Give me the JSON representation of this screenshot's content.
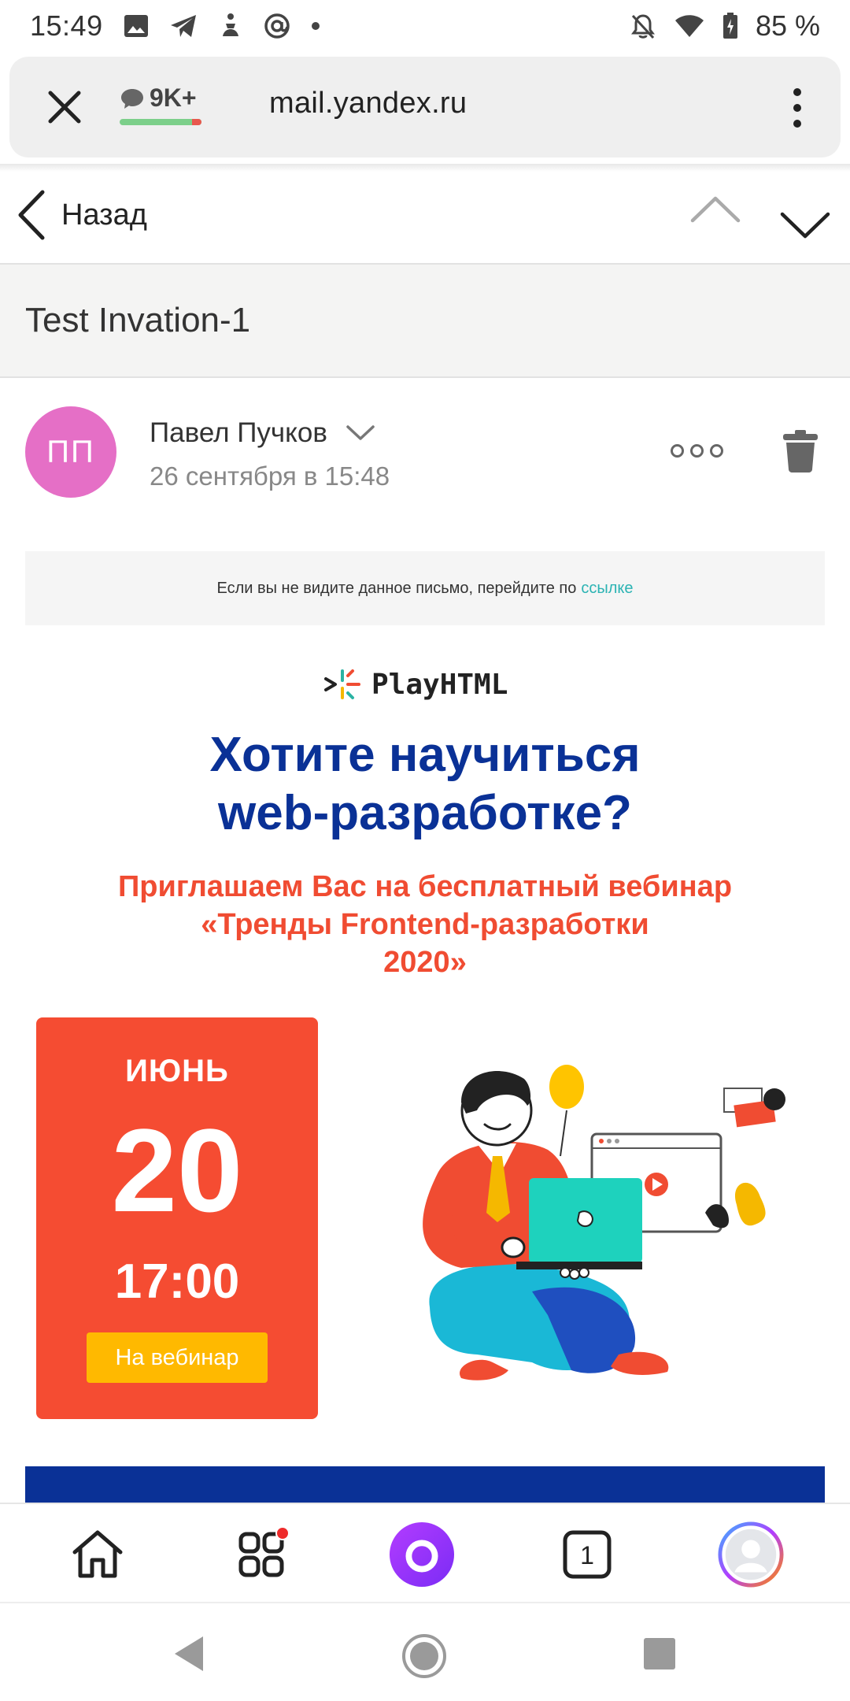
{
  "status_bar": {
    "time": "15:49",
    "battery": "85 %"
  },
  "browser": {
    "comments_count": "9K+",
    "url": "mail.yandex.ru"
  },
  "nav": {
    "back_label": "Назад"
  },
  "email": {
    "subject": "Test Invation-1",
    "sender_initials": "ПП",
    "sender_name": "Павел Пучков",
    "date": "26 сентября в 15:48",
    "avatar_color": "#e56fc6"
  },
  "body": {
    "notice_text": "Если вы не видите данное письмо, перейдите по",
    "notice_link": "ссылке",
    "logo_name": "PlayHTML",
    "headline_line1": "Хотите научиться",
    "headline_line2": "web-разработке?",
    "subhead_line1": "Приглашаем Вас на бесплатный вебинар",
    "subhead_line2": "«Тренды Frontend-разработки",
    "subhead_line3": "2020»",
    "event": {
      "month": "ИЮНЬ",
      "day": "20",
      "time": "17:00",
      "cta": "На вебинар"
    },
    "colors": {
      "headline": "#0a3196",
      "accent": "#f04c32",
      "cta": "#ffb900"
    }
  },
  "bottom_bar": {
    "tabs_count": "1"
  }
}
